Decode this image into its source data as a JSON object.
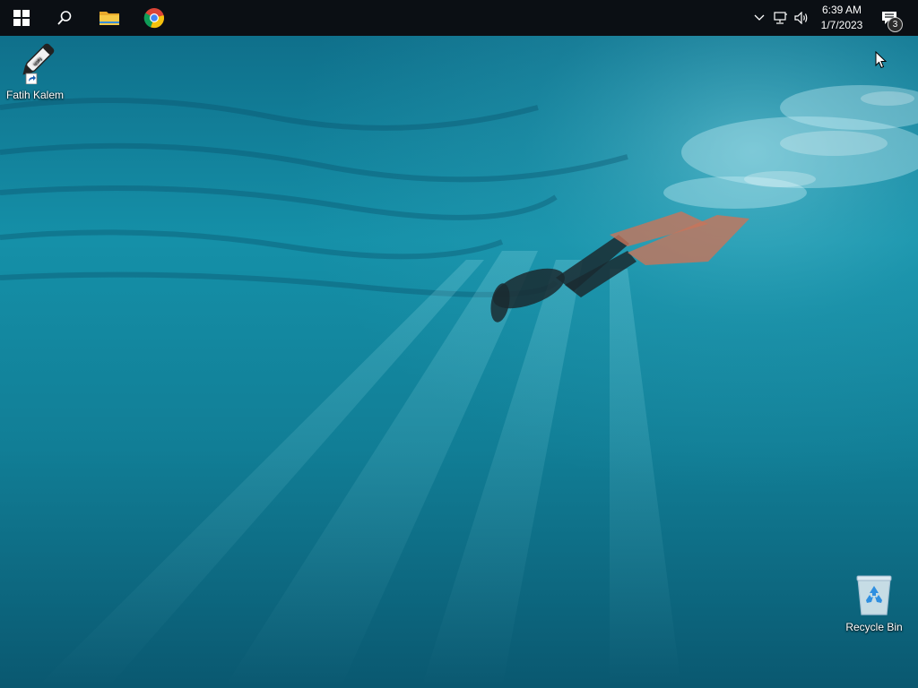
{
  "taskbar": {
    "start": {
      "icon": "windows-logo-icon"
    },
    "search": {
      "icon": "search-icon"
    },
    "pinned": [
      {
        "name": "File Explorer",
        "icon": "folder-icon"
      },
      {
        "name": "Google Chrome",
        "icon": "chrome-icon"
      }
    ],
    "tray": {
      "overflow_icon": "chevron-up-icon",
      "network_icon": "network-icon",
      "volume_icon": "volume-icon",
      "time": "6:39 AM",
      "date": "1/7/2023",
      "notification_icon": "action-center-icon",
      "notification_count": "3"
    }
  },
  "desktop": {
    "icons": [
      {
        "label": "Fatih Kalem",
        "icon": "pen-shortcut-icon"
      },
      {
        "label": "Recycle Bin",
        "icon": "recycle-bin-icon"
      }
    ]
  },
  "colors": {
    "taskbar": "#0b0f14",
    "water_top": "#0d5f7a",
    "water_mid": "#127f98",
    "water_bottom": "#0b5a72"
  }
}
